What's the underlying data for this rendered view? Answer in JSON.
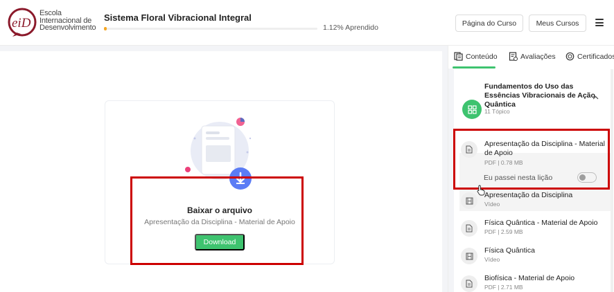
{
  "logo": {
    "mark_text": "eiD",
    "lines": [
      "Escola",
      "Internacional de",
      "Desenvolvimento"
    ]
  },
  "course": {
    "title": "Sistema Floral Vibracional Integral",
    "progress_percent": 1.12,
    "progress_label": "1.12% Aprendido"
  },
  "header_buttons": {
    "pagina": "Página do Curso",
    "meus": "Meus Cursos"
  },
  "download_card": {
    "title": "Baixar o arquivo",
    "subtitle": "Apresentação da Disciplina - Material de Apoio",
    "button": "Download"
  },
  "tabs": [
    {
      "label": "Conteúdo",
      "icon": "toc-icon",
      "active": true
    },
    {
      "label": "Avaliações",
      "icon": "quiz-icon",
      "active": false
    },
    {
      "label": "Certificados",
      "icon": "certificate-icon",
      "active": false
    }
  ],
  "section": {
    "title": "Fundamentos do Uso das Essências Vibracionais de Ação Quântica",
    "count": "11 Tópico"
  },
  "lessons": [
    {
      "title": "Apresentação da Disciplina - Material de Apoio",
      "meta": "PDF | 0.78 MB",
      "icon": "document-icon"
    },
    {
      "title": "Apresentação da Disciplina",
      "meta": "Vídeo",
      "icon": "video-icon"
    },
    {
      "title": "Física Quântica - Material de Apoio",
      "meta": "PDF | 2.59 MB",
      "icon": "document-icon"
    },
    {
      "title": "Física Quântica",
      "meta": "Vídeo",
      "icon": "video-icon"
    },
    {
      "title": "Biofísica - Material de Apoio",
      "meta": "PDF | 2.71 MB",
      "icon": "document-icon"
    }
  ],
  "passed_label": "Eu passei nesta lição",
  "colors": {
    "accent_green": "#3ec36f",
    "highlight_red": "#cc0000",
    "logo_maroon": "#8b1a2b",
    "progress_orange": "#f5a623"
  }
}
